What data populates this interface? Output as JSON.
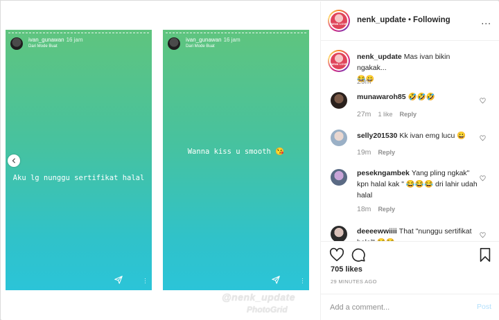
{
  "stories": [
    {
      "username": "ivan_gunawan",
      "time": "16 jam",
      "subtitle": "Dari Mode Buat",
      "caption": "Aku lg nunggu sertifikat halal"
    },
    {
      "username": "ivan_gunawan",
      "time": "16 jam",
      "subtitle": "Dari Mode Buat",
      "caption": "Wanna kiss u smooth 😘"
    }
  ],
  "watermark": {
    "line1": "@nenk_update",
    "line2": "PhotoGrid"
  },
  "header": {
    "username": "nenk_update",
    "separator": "•",
    "follow_status": "Following",
    "avatar_label": "NENK LOVE",
    "more": "..."
  },
  "caption": {
    "username": "nenk_update",
    "text": "Mas ivan bikin ngakak...",
    "emojis": "😂😀",
    "time": "29m"
  },
  "comments": [
    {
      "username": "munawaroh85",
      "text": "🤣🤣🤣",
      "time": "27m",
      "likes": "1 like",
      "reply": "Reply"
    },
    {
      "username": "selly201530",
      "text": "Kk ivan emg lucu 😀",
      "time": "19m",
      "reply": "Reply"
    },
    {
      "username": "pesekngambek",
      "text": "Yang pling ngkak\" kpn halal kak \" 😂😂😂 dri lahir udah halal",
      "time": "18m",
      "reply": "Reply"
    },
    {
      "username": "deeeewwiiii",
      "text": "That \"nunggu sertifikat halal\" 😂😂",
      "time": "",
      "reply": ""
    }
  ],
  "stats": {
    "likes": "705 likes",
    "posted": "29 MINUTES AGO"
  },
  "add_comment": {
    "placeholder": "Add a comment...",
    "post_label": "Post"
  },
  "colors": {
    "story_top": "#5fc47e",
    "story_bottom": "#2bc4d8",
    "link_blue": "#b2dffc",
    "muted": "#8e8e8e"
  }
}
